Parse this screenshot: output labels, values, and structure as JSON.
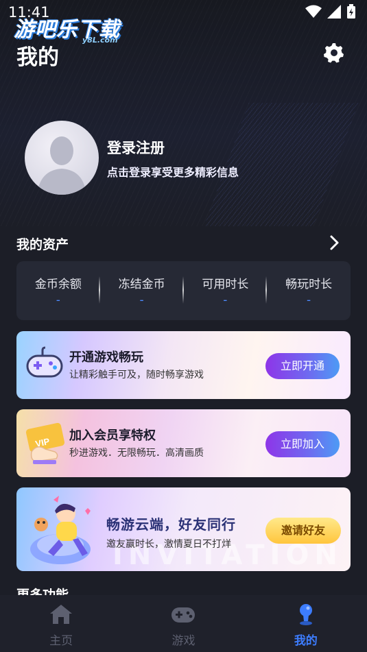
{
  "status_bar": {
    "time": "11:41"
  },
  "watermark": {
    "main": "游吧乐下载",
    "sub": "y8L.com"
  },
  "header": {
    "title": "我的"
  },
  "profile": {
    "login_title": "登录注册",
    "login_subtitle": "点击登录享受更多精彩信息"
  },
  "assets": {
    "title": "我的资产",
    "items": [
      {
        "label": "金币余额",
        "value": "-"
      },
      {
        "label": "冻结金币",
        "value": "-"
      },
      {
        "label": "可用时长",
        "value": "-"
      },
      {
        "label": "畅玩时长",
        "value": "-"
      }
    ]
  },
  "promos": [
    {
      "title": "开通游戏畅玩",
      "subtitle": "让精彩触手可及，随时畅享游戏",
      "button": "立即开通"
    },
    {
      "title": "加入会员享特权",
      "subtitle": "秒进游戏．无限畅玩．高清画质",
      "button": "立即加入",
      "badge": "VIP"
    },
    {
      "title": "畅游云端，好友同行",
      "subtitle": "邀友赢时长，激情夏日不打烊",
      "button": "邀请好友",
      "bg_text": "INVITATION"
    }
  ],
  "more": {
    "title": "更多功能"
  },
  "nav": [
    {
      "label": "主页",
      "icon": "home-icon"
    },
    {
      "label": "游戏",
      "icon": "gamepad-icon"
    },
    {
      "label": "我的",
      "icon": "profile-icon",
      "active": true
    }
  ],
  "colors": {
    "accent": "#3d7dff",
    "background": "#1c1e27",
    "card": "#262935"
  }
}
